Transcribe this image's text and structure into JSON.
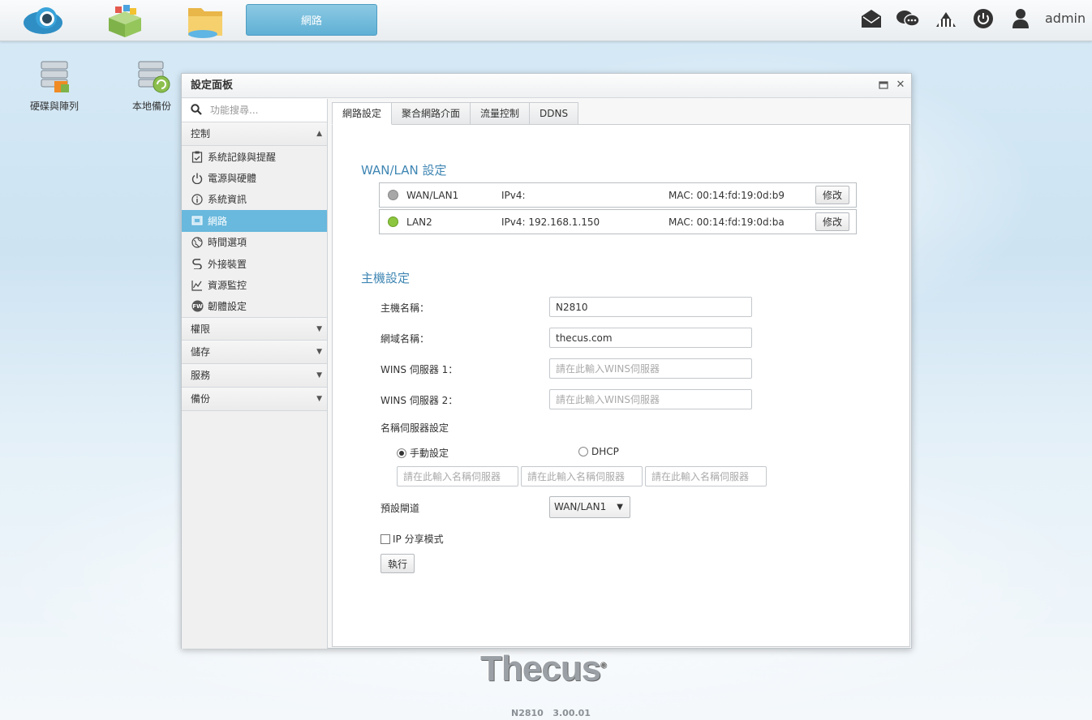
{
  "taskbar": {
    "active_app_label": "網路",
    "user": "admin",
    "icons": [
      "cloud-app-icon",
      "app-center-icon",
      "file-manager-icon",
      "mail-icon",
      "chat-icon",
      "network-status-icon",
      "power-icon",
      "user-icon"
    ]
  },
  "desktop": {
    "icons": [
      {
        "label": "硬碟與陣列",
        "icon": "disk-raid-icon"
      },
      {
        "label": "本地備份",
        "icon": "local-backup-icon"
      }
    ]
  },
  "window": {
    "title": "設定面板",
    "search_placeholder": "功能搜尋...",
    "sidebar": {
      "groups": [
        {
          "label": "控制",
          "expanded": true
        },
        {
          "label": "權限",
          "expanded": false
        },
        {
          "label": "儲存",
          "expanded": false
        },
        {
          "label": "服務",
          "expanded": false
        },
        {
          "label": "備份",
          "expanded": false
        }
      ],
      "items": [
        {
          "label": "系統記錄與提醒",
          "icon": "clipboard-icon"
        },
        {
          "label": "電源與硬體",
          "icon": "power-icon"
        },
        {
          "label": "系統資訊",
          "icon": "info-icon"
        },
        {
          "label": "網路",
          "icon": "network-icon",
          "active": true
        },
        {
          "label": "時間選項",
          "icon": "globe-icon"
        },
        {
          "label": "外接裝置",
          "icon": "usb-icon"
        },
        {
          "label": "資源監控",
          "icon": "chart-icon"
        },
        {
          "label": "韌體設定",
          "icon": "firmware-icon"
        }
      ]
    },
    "tabs": [
      "網路設定",
      "聚合網路介面",
      "流量控制",
      "DDNS"
    ],
    "wan_section_title": "WAN/LAN 設定",
    "nics": [
      {
        "name": "WAN/LAN1",
        "ipv4": "IPv4:",
        "mac": "MAC: 00:14:fd:19:0d:b9",
        "status_color": "#a8a8a8",
        "button": "修改"
      },
      {
        "name": "LAN2",
        "ipv4": "IPv4: 192.168.1.150",
        "mac": "MAC: 00:14:fd:19:0d:ba",
        "status_color": "#8cc63f",
        "button": "修改"
      }
    ],
    "host_section_title": "主機設定",
    "host": {
      "hostname_label": "主機名稱：",
      "hostname_value": "N2810",
      "domain_label": "網域名稱：",
      "domain_value": "thecus.com",
      "wins1_label": "WINS 伺服器 1：",
      "wins1_placeholder": "請在此輸入WINS伺服器",
      "wins2_label": "WINS 伺服器 2：",
      "wins2_placeholder": "請在此輸入WINS伺服器",
      "dns_label": "名稱伺服器設定",
      "dns_manual": "手動設定",
      "dns_dhcp": "DHCP",
      "dns_mode": "manual",
      "dns_placeholder": "請在此輸入名稱伺服器",
      "gateway_label": "預設閘道",
      "gateway_value": "WAN/LAN1",
      "ip_sharing_label": "IP 分享模式",
      "apply_button": "執行"
    }
  },
  "footer": {
    "logo_text": "Thecus",
    "model": "N2810",
    "version": "3.00.01"
  }
}
